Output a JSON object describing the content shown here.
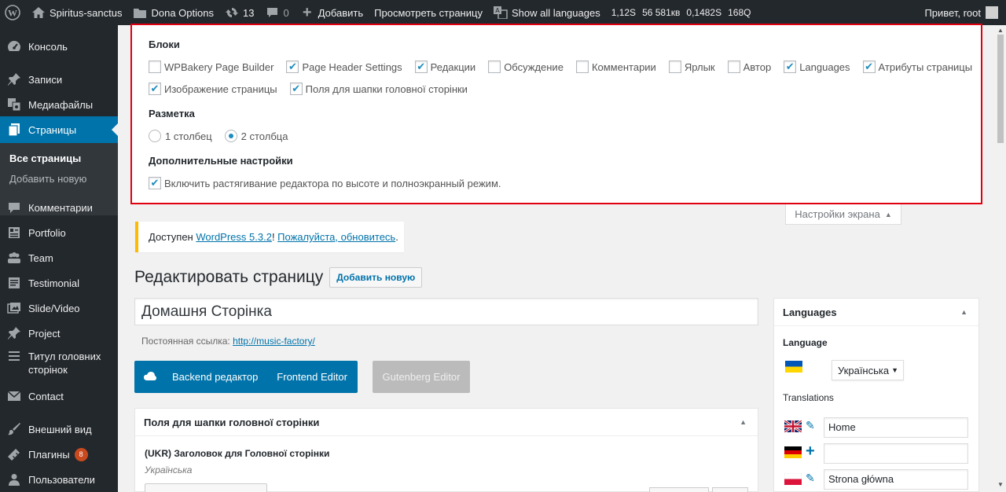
{
  "adminbar": {
    "site_name": "Spiritus-sanctus",
    "dona_options": "Dona Options",
    "updates_count": "13",
    "comments_count": "0",
    "add_new": "Добавить",
    "view_page": "Просмотреть страницу",
    "show_languages": "Show all languages",
    "stats": [
      "1,12S",
      "56 581кв",
      "0,1482S",
      "168Q"
    ],
    "greeting": "Привет, root"
  },
  "sidebar": {
    "items": [
      {
        "label": "Консоль",
        "icon": "dashboard-icon"
      },
      {
        "label": "Записи",
        "icon": "pin-icon"
      },
      {
        "label": "Медиафайлы",
        "icon": "media-icon"
      },
      {
        "label": "Страницы",
        "icon": "pages-icon"
      },
      {
        "label": "Комментарии",
        "icon": "comments-icon"
      },
      {
        "label": "Portfolio",
        "icon": "portfolio-icon"
      },
      {
        "label": "Team",
        "icon": "team-icon"
      },
      {
        "label": "Testimonial",
        "icon": "testimonial-icon"
      },
      {
        "label": "Slide/Video",
        "icon": "slide-icon"
      },
      {
        "label": "Project",
        "icon": "project-pin-icon"
      },
      {
        "label": "Титул головних сторінок",
        "icon": "list-icon"
      },
      {
        "label": "Contact",
        "icon": "mail-icon"
      },
      {
        "label": "Внешний вид",
        "icon": "brush-icon"
      },
      {
        "label": "Плагины",
        "icon": "plugin-icon",
        "badge": "8"
      },
      {
        "label": "Пользователи",
        "icon": "user-icon"
      }
    ],
    "submenu": [
      "Все страницы",
      "Добавить новую"
    ]
  },
  "screen_options": {
    "blocks_title": "Блоки",
    "blocks": [
      {
        "label": "WPBakery Page Builder",
        "checked": false
      },
      {
        "label": "Page Header Settings",
        "checked": true
      },
      {
        "label": "Редакции",
        "checked": true
      },
      {
        "label": "Обсуждение",
        "checked": false
      },
      {
        "label": "Комментарии",
        "checked": false
      },
      {
        "label": "Ярлык",
        "checked": false
      },
      {
        "label": "Автор",
        "checked": false
      },
      {
        "label": "Languages",
        "checked": true
      },
      {
        "label": "Атрибуты страницы",
        "checked": true
      },
      {
        "label": "Изображение страницы",
        "checked": true
      },
      {
        "label": "Поля для шапки головної сторінки",
        "checked": true
      }
    ],
    "layout_title": "Разметка",
    "layout_options": [
      {
        "label": "1 столбец",
        "checked": false
      },
      {
        "label": "2 столбца",
        "checked": true
      }
    ],
    "extra_title": "Дополнительные настройки",
    "extra_option": {
      "label": "Включить растягивание редактора по высоте и полноэкранный режим.",
      "checked": true
    },
    "tab_label": "Настройки экрана"
  },
  "notice": {
    "prefix": "Доступен ",
    "link1": "WordPress 5.3.2",
    "middle": "! ",
    "link2": "Пожалуйста, обновитесь",
    "suffix": "."
  },
  "editor": {
    "heading": "Редактировать страницу",
    "add_new": "Добавить новую",
    "title_value": "Домашня Сторінка",
    "permalink_label": "Постоянная ссылка:",
    "permalink_url": "http://music-factory/",
    "backend_btn": "Backend редактор",
    "frontend_btn": "Frontend Editor",
    "gutenberg_btn": "Gutenberg Editor",
    "metabox_title": "Поля для шапки головної сторінки",
    "field_title": "(UKR) Заголовок для Головної сторінки",
    "field_lang": "Українська"
  },
  "languages": {
    "title": "Languages",
    "language_label": "Language",
    "selected": "Українська",
    "translations_label": "Translations",
    "translations": [
      {
        "flag": "uk",
        "value": "Home",
        "action": "edit-icon"
      },
      {
        "flag": "de",
        "value": "",
        "action": "plus-icon"
      },
      {
        "flag": "pl",
        "value": "Strona główna",
        "action": "edit-icon"
      }
    ]
  }
}
